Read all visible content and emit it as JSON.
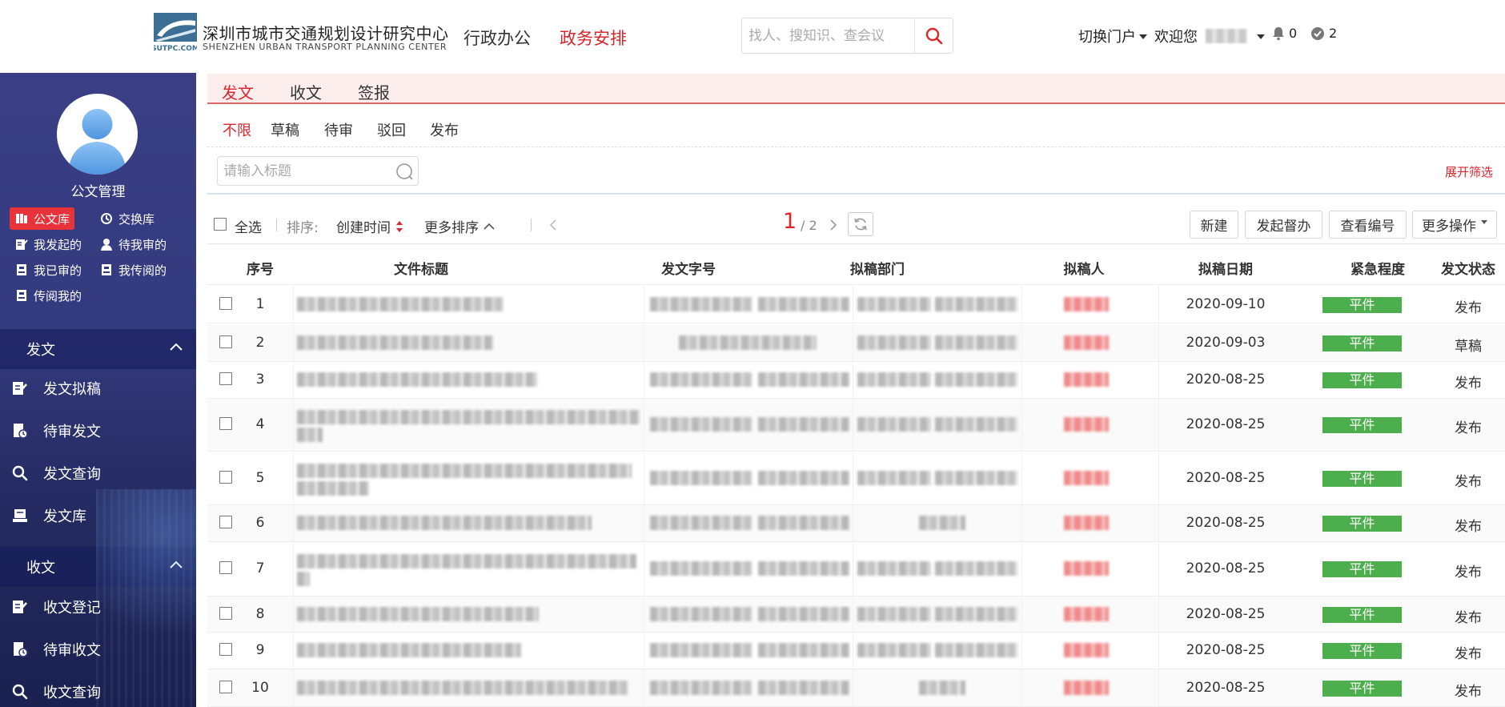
{
  "header": {
    "org_cn": "深圳市城市交通规划设计研究中心",
    "org_en": "SHENZHEN URBAN TRANSPORT PLANNING CENTER",
    "logo_text": "SUTPC.COM",
    "nav": [
      "行政办公",
      "政务安排"
    ],
    "search_placeholder": "找人、搜知识、查会议",
    "switch_portal": "切换门户",
    "welcome": "欢迎您",
    "bell_count": "0",
    "msg_count": "2"
  },
  "sidebar": {
    "title": "公文管理",
    "quick": [
      "公文库",
      "交换库",
      "我发起的",
      "待我审的",
      "我已审的",
      "我传阅的",
      "传阅我的"
    ],
    "sections": [
      {
        "title": "发文",
        "items": [
          "发文拟稿",
          "待审发文",
          "发文查询",
          "发文库"
        ]
      },
      {
        "title": "收文",
        "items": [
          "收文登记",
          "待审收文",
          "收文查询"
        ]
      }
    ]
  },
  "tabs": [
    "发文",
    "收文",
    "签报"
  ],
  "filters": [
    "不限",
    "草稿",
    "待审",
    "驳回",
    "发布"
  ],
  "title_search_placeholder": "请输入标题",
  "expand_filter": "展开筛选",
  "toolbar": {
    "select_all": "全选",
    "sort_label": "排序:",
    "sort_by": "创建时间",
    "more_sort": "更多排序",
    "page_current": "1",
    "page_total": "/ 2",
    "buttons": [
      "新建",
      "发起督办",
      "查看编号",
      "更多操作"
    ]
  },
  "columns": [
    "序号",
    "文件标题",
    "发文字号",
    "拟稿部门",
    "拟稿人",
    "拟稿日期",
    "紧急程度",
    "发文状态"
  ],
  "rows": [
    {
      "no": "1",
      "date": "2020-09-10",
      "urgency": "平件",
      "status": "发布"
    },
    {
      "no": "2",
      "date": "2020-09-03",
      "urgency": "平件",
      "status": "草稿"
    },
    {
      "no": "3",
      "date": "2020-08-25",
      "urgency": "平件",
      "status": "发布"
    },
    {
      "no": "4",
      "date": "2020-08-25",
      "urgency": "平件",
      "status": "发布"
    },
    {
      "no": "5",
      "date": "2020-08-25",
      "urgency": "平件",
      "status": "发布"
    },
    {
      "no": "6",
      "date": "2020-08-25",
      "urgency": "平件",
      "status": "发布"
    },
    {
      "no": "7",
      "date": "2020-08-25",
      "urgency": "平件",
      "status": "发布"
    },
    {
      "no": "8",
      "date": "2020-08-25",
      "urgency": "平件",
      "status": "发布"
    },
    {
      "no": "9",
      "date": "2020-08-25",
      "urgency": "平件",
      "status": "发布"
    },
    {
      "no": "10",
      "date": "2020-08-25",
      "urgency": "平件",
      "status": "发布"
    }
  ],
  "colors": {
    "accent": "#d9262c",
    "badge": "#4cae4c",
    "sidebar": "#343a7e"
  }
}
